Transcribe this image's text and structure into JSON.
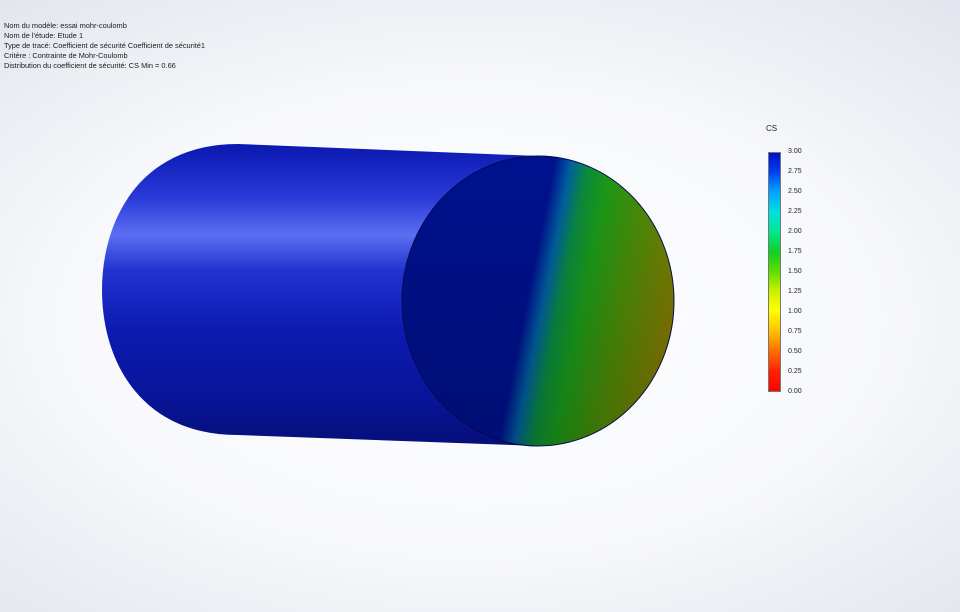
{
  "info": {
    "lines": [
      "Nom du modèle: essai mohr-coulomb",
      "Nom de l'étude: Etude 1",
      "Type de tracé: Coefficient de sécurité Coefficient de sécurité1",
      "Critère : Contrainte de Mohr-Coulomb",
      "Distribution du coefficient de sécurité: CS Min = 0.66"
    ]
  },
  "legend": {
    "title": "CS",
    "ticks": [
      "3.00",
      "2.75",
      "2.50",
      "2.25",
      "2.00",
      "1.75",
      "1.50",
      "1.25",
      "1.00",
      "0.75",
      "0.50",
      "0.25",
      "0.00"
    ],
    "range": [
      0,
      3
    ],
    "colors": {
      "max": "#0010c8",
      "mid": "#10d020",
      "low": "#ffff00",
      "min": "#ff0000"
    }
  },
  "model": {
    "shape": "cylinder",
    "body_color": "#0a1aa0",
    "highlight_color": "#5a6cf0",
    "face_color": "#00108a",
    "gradient_band_colors": [
      "#00108a",
      "#0b8a4a",
      "#1a9a10",
      "#6a8a00",
      "#8a7a00"
    ]
  }
}
